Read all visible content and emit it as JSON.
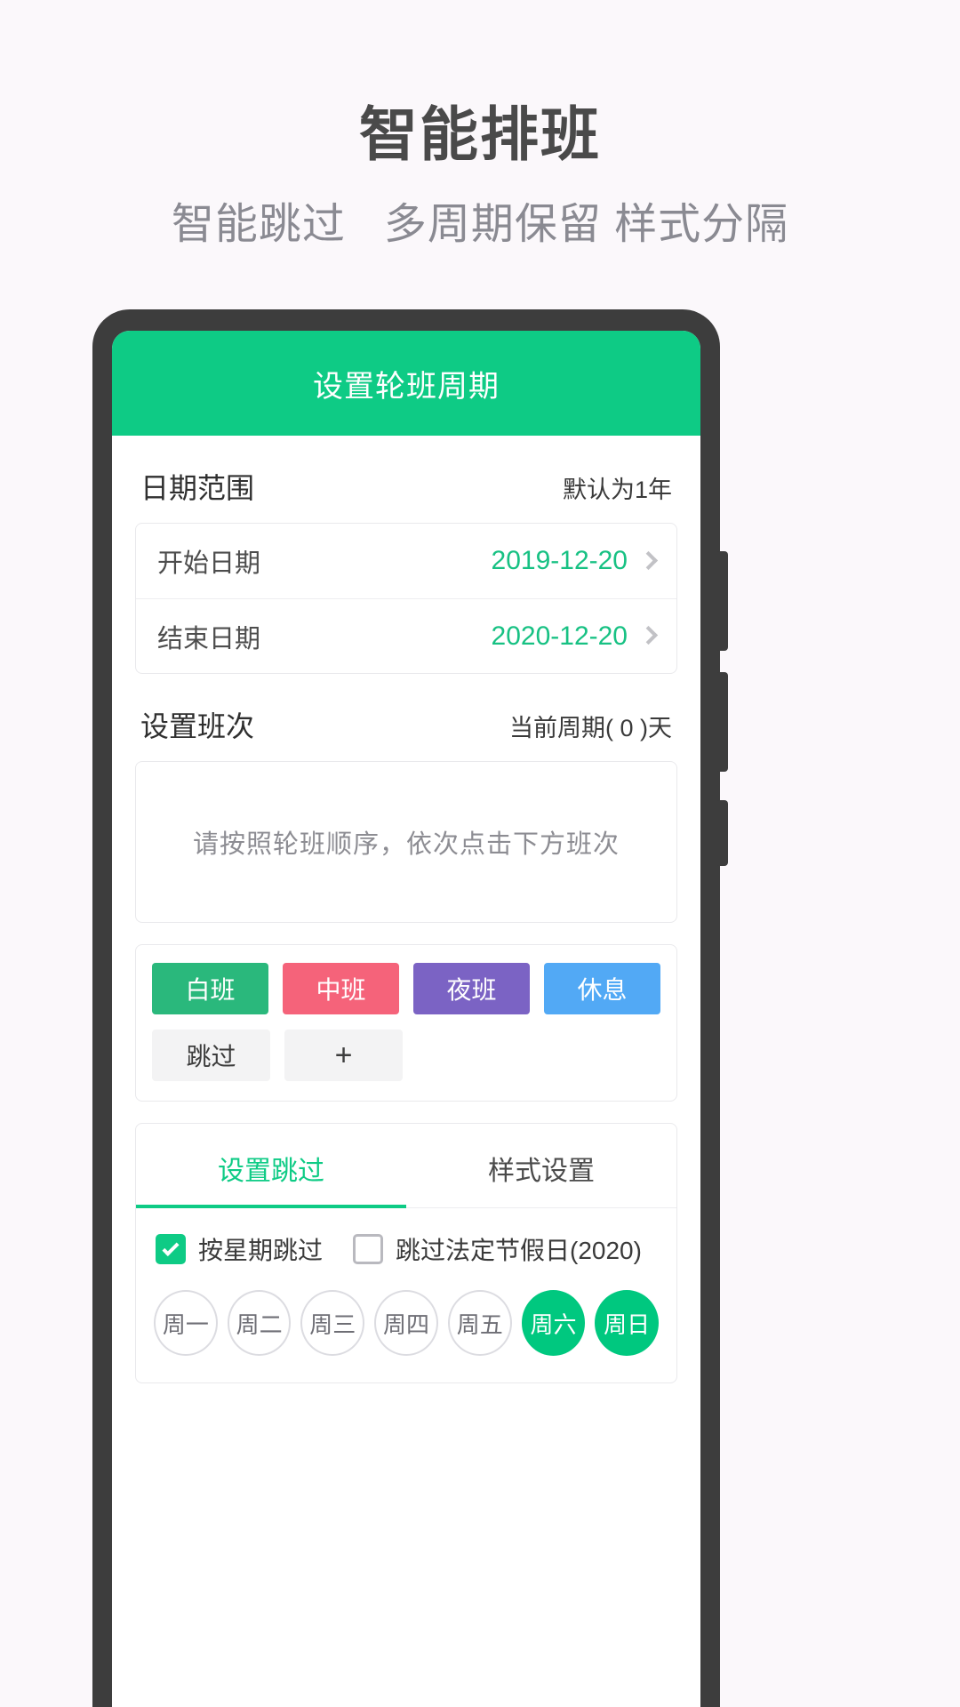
{
  "promo": {
    "title": "智能排班",
    "subtitle": "智能跳过   多周期保留 样式分隔"
  },
  "colors": {
    "brand_green": "#0ecb85",
    "value_green": "#17c183",
    "frame_dark": "#3d3d3d",
    "page_bg": "#fbf8fb"
  },
  "app": {
    "title": "设置轮班周期",
    "date_section": {
      "title": "日期范围",
      "note": "默认为1年",
      "rows": [
        {
          "label": "开始日期",
          "value": "2019-12-20"
        },
        {
          "label": "结束日期",
          "value": "2020-12-20"
        }
      ]
    },
    "shift_section": {
      "title": "设置班次",
      "note": "当前周期( 0 )天",
      "hint": "请按照轮班顺序，依次点击下方班次"
    },
    "palette": {
      "row1": [
        {
          "label": "白班",
          "color": "#2ab87c"
        },
        {
          "label": "中班",
          "color": "#f5637a"
        },
        {
          "label": "夜班",
          "color": "#7b63c4"
        },
        {
          "label": "休息",
          "color": "#52a9f5"
        }
      ],
      "row2": [
        {
          "label": "跳过"
        },
        {
          "label": "+"
        }
      ]
    },
    "tabs": [
      {
        "label": "设置跳过",
        "active": true
      },
      {
        "label": "样式设置",
        "active": false
      }
    ],
    "checks": [
      {
        "label": "按星期跳过",
        "checked": true
      },
      {
        "label": "跳过法定节假日(2020)",
        "checked": false
      }
    ],
    "weekdays": [
      {
        "label": "周一",
        "selected": false
      },
      {
        "label": "周二",
        "selected": false
      },
      {
        "label": "周三",
        "selected": false
      },
      {
        "label": "周四",
        "selected": false
      },
      {
        "label": "周五",
        "selected": false
      },
      {
        "label": "周六",
        "selected": true
      },
      {
        "label": "周日",
        "selected": true
      }
    ]
  }
}
